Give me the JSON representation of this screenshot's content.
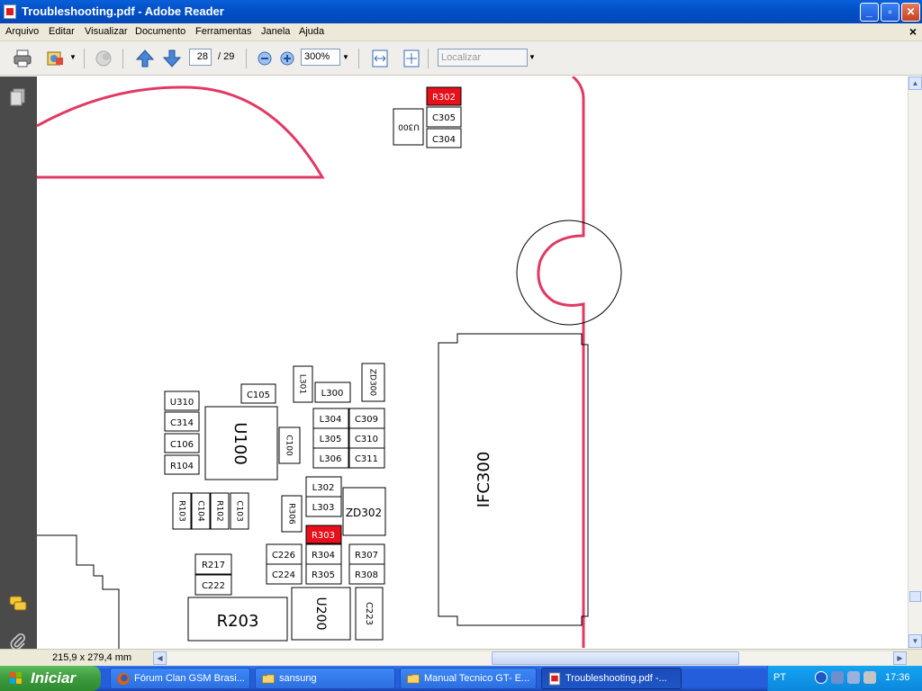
{
  "window": {
    "title": "Troubleshooting.pdf - Adobe Reader",
    "buttons": {
      "minimize": "_",
      "maximize": "▫",
      "close": "✕"
    }
  },
  "menu": {
    "items": [
      "Arquivo",
      "Editar",
      "Visualizar",
      "Documento",
      "Ferramentas",
      "Janela",
      "Ajuda"
    ],
    "close_doc": "×"
  },
  "toolbar": {
    "page_current": "28",
    "page_total": "/ 29",
    "zoom": "300%",
    "search_placeholder": "Localizar",
    "icons": [
      "print-icon",
      "edit-icon",
      "hand-icon",
      "page-up-icon",
      "page-down-icon",
      "zoom-out-icon",
      "zoom-in-icon",
      "fit-width-icon",
      "fit-page-icon"
    ]
  },
  "statusbar": {
    "page_size": "215,9 x 279,4 mm"
  },
  "document": {
    "components": {
      "r302": "R302",
      "c305": "C305",
      "c304": "C304",
      "u300": "U300",
      "u310": "U310",
      "c314": "C314",
      "c106": "C106",
      "r104": "R104",
      "c105": "C105",
      "u100": "U100",
      "c100": "C100",
      "l301": "L301",
      "l300": "L300",
      "zd300": "ZD300",
      "l304": "L304",
      "c309": "C309",
      "l305": "L305",
      "c310": "C310",
      "l306": "L306",
      "c311": "C311",
      "r103": "R103",
      "c104": "C104",
      "r102": "R102",
      "c103": "C103",
      "l302": "L302",
      "l303": "L303",
      "r306": "R306",
      "zd302": "ZD302",
      "r303": "R303",
      "c226": "C226",
      "r304": "R304",
      "r307": "R307",
      "c224": "C224",
      "r305": "R305",
      "r308": "R308",
      "r217": "R217",
      "c222": "C222",
      "r203": "R203",
      "u200": "U200",
      "c223": "C223",
      "ifc300": "IFC300"
    },
    "highlight_color": "#e8101a",
    "outline_color": "#e03a64"
  },
  "taskbar": {
    "start": "Iniciar",
    "tasks": [
      {
        "label": "Fórum Clan GSM Brasi...",
        "icon": "firefox-icon"
      },
      {
        "label": "sansung",
        "icon": "folder-icon"
      },
      {
        "label": "Manual Tecnico GT- E...",
        "icon": "folder-icon"
      },
      {
        "label": "Troubleshooting.pdf -...",
        "icon": "pdf-icon"
      }
    ],
    "language": "PT",
    "time": "17:36"
  }
}
